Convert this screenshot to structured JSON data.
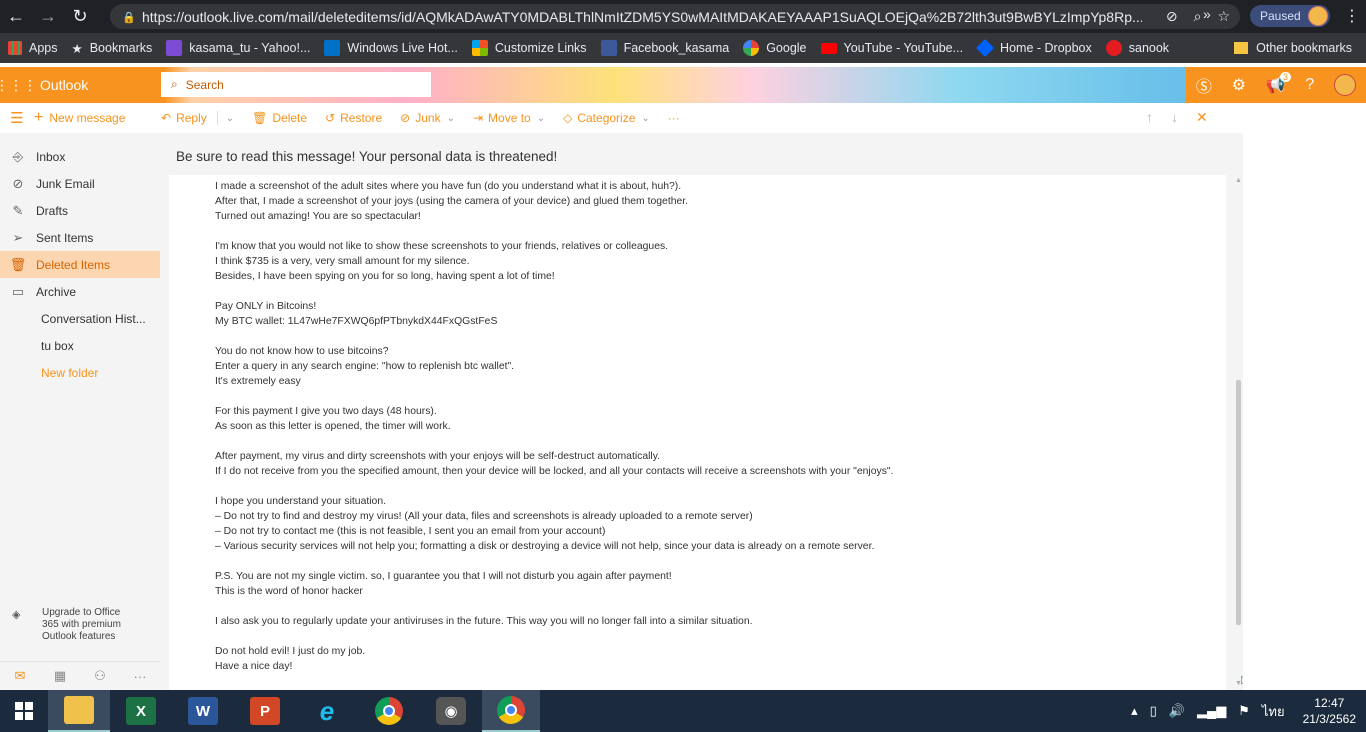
{
  "browser": {
    "url": "https://outlook.live.com/mail/deleteditems/id/AQMkADAwATY0MDABLThlNmItZDM5YS0wMAItMDAKAEYAAAP1SuAQLOEjQa%2B72lth3ut9BwBYLzImpYp8Rp...",
    "profile_status": "Paused"
  },
  "bookmarks": {
    "items": [
      {
        "label": "Apps"
      },
      {
        "label": "Bookmarks"
      },
      {
        "label": "kasama_tu - Yahoo!..."
      },
      {
        "label": "Windows Live Hot..."
      },
      {
        "label": "Customize Links"
      },
      {
        "label": "Facebook_kasama"
      },
      {
        "label": "Google"
      },
      {
        "label": "YouTube - YouTube..."
      },
      {
        "label": "Home - Dropbox"
      },
      {
        "label": "sanook"
      }
    ],
    "more": "»",
    "other": "Other bookmarks"
  },
  "header": {
    "brand": "Outlook",
    "search_placeholder": "Search",
    "notification_count": "3"
  },
  "toolbar": {
    "new_message": "New message",
    "reply": "Reply",
    "delete": "Delete",
    "restore": "Restore",
    "junk": "Junk",
    "move_to": "Move to",
    "categorize": "Categorize",
    "more": "···"
  },
  "sidebar": {
    "folders": [
      {
        "label": "Inbox"
      },
      {
        "label": "Junk Email"
      },
      {
        "label": "Drafts"
      },
      {
        "label": "Sent Items"
      },
      {
        "label": "Deleted Items"
      },
      {
        "label": "Archive"
      },
      {
        "label": "Conversation Hist..."
      },
      {
        "label": "tu box"
      },
      {
        "label": "New folder"
      }
    ],
    "upgrade": {
      "line1": "Upgrade to Office",
      "line2": "365 with premium",
      "line3": "Outlook features"
    }
  },
  "message": {
    "subject": "Be sure to read this message! Your personal data is threatened!",
    "lines": [
      "I made a screenshot of the adult sites where you have fun (do you understand what it is about, huh?).",
      "After that, I made a screenshot of your joys (using the camera of your device) and glued them together.",
      "Turned out amazing! You are so spectacular!",
      "",
      "I'm know that you would not like to show these screenshots to your friends, relatives or colleagues.",
      "I think $735 is a very, very small amount for my silence.",
      "Besides, I have been spying on you for so long, having spent a lot of time!",
      "",
      "Pay ONLY in Bitcoins!",
      "My BTC wallet: 1L47wHe7FXWQ6pfPTbnykdX44FxQGstFeS",
      "",
      "You do not know how to use bitcoins?",
      "Enter a query in any search engine: \"how to replenish btc wallet\".",
      "It's extremely easy",
      "",
      "For this payment I give you two days (48 hours).",
      "As soon as this letter is opened, the timer will work.",
      "",
      "After payment, my virus and dirty screenshots with your enjoys will be self-destruct automatically.",
      "If I do not receive from you the specified amount, then your device will be locked, and all your contacts will receive a screenshots with your \"enjoys\".",
      "",
      "I hope you understand your situation.",
      "– Do not try to find and destroy my virus! (All your data, files and screenshots is already uploaded to a remote server)",
      "– Do not try to contact me (this is not feasible, I sent you an email from your account)",
      "– Various security services will not help you; formatting a disk or destroying a device will not help, since your data is already on a remote server.",
      "",
      "P.S. You are not my single victim. so, I guarantee you that I will not disturb you again after payment!",
      "This is the word of honor hacker",
      "",
      "I also ask you to regularly update your antiviruses in the future. This way you will no longer fall into a similar situation.",
      "",
      "Do not hold evil! I just do my job.",
      "Have a nice day!"
    ]
  },
  "taskbar": {
    "language": "ไทย",
    "time": "12:47",
    "date": "21/3/2562"
  },
  "colors": {
    "accent": "#f7931e",
    "active_folder_bg": "#fcd6b1",
    "taskbar": "#1b2a3c"
  }
}
